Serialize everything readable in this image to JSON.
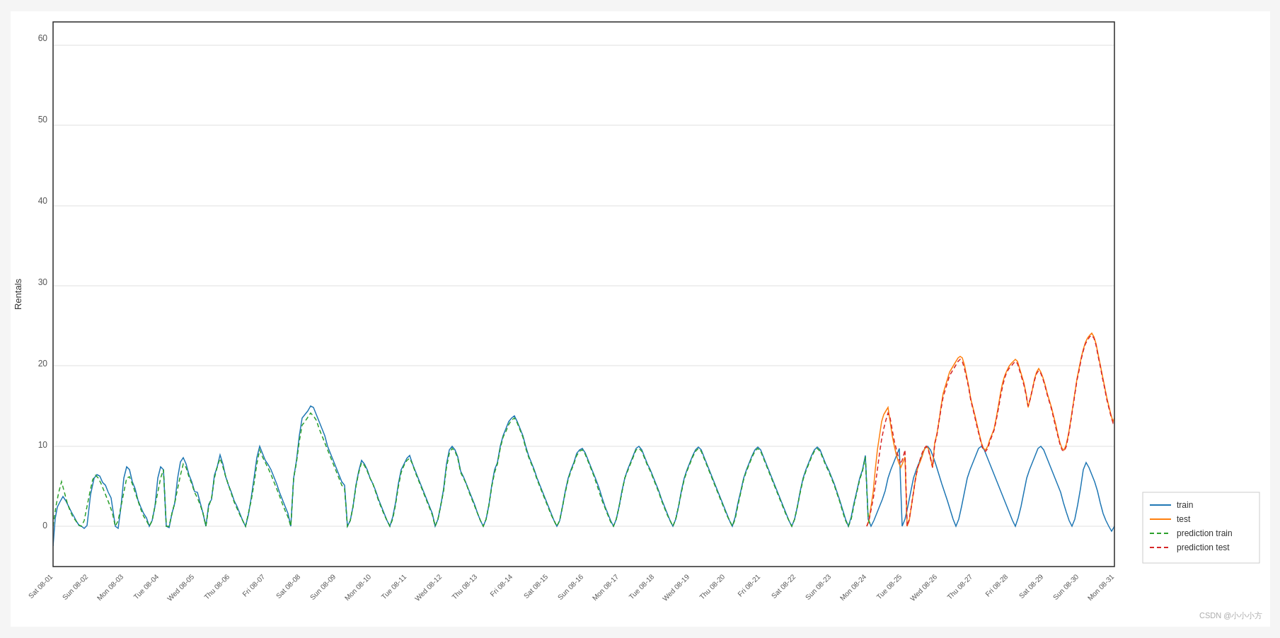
{
  "chart": {
    "title": "",
    "y_label": "Rentals",
    "x_label": "",
    "y_min": -5,
    "y_max": 60,
    "y_ticks": [
      0,
      10,
      20,
      30,
      40,
      50,
      60
    ],
    "x_labels": [
      "Sat 08-01",
      "Sun 08-02",
      "Mon 08-03",
      "Tue 08-04",
      "Wed 08-05",
      "Thu 08-06",
      "Fri 08-07",
      "Sat 08-08",
      "Sun 08-09",
      "Mon 08-10",
      "Tue 08-11",
      "Wed 08-12",
      "Thu 08-13",
      "Fri 08-14",
      "Sat 08-15",
      "Sun 08-16",
      "Mon 08-17",
      "Tue 08-18",
      "Wed 08-19",
      "Thu 08-20",
      "Fri 08-21",
      "Sat 08-22",
      "Sun 08-23",
      "Mon 08-24",
      "Tue 08-25",
      "Wed 08-26",
      "Thu 08-27",
      "Fri 08-28",
      "Sat 08-29",
      "Sun 08-30",
      "Mon 08-31"
    ],
    "legend": {
      "train_label": "train",
      "test_label": "test",
      "pred_train_label": "prediction train",
      "pred_test_label": "prediction test"
    },
    "colors": {
      "train": "#1f77b4",
      "test": "#ff7f0e",
      "pred_train": "#2ca02c",
      "pred_test": "#d62728"
    }
  },
  "watermark": "CSDN @小小小方"
}
